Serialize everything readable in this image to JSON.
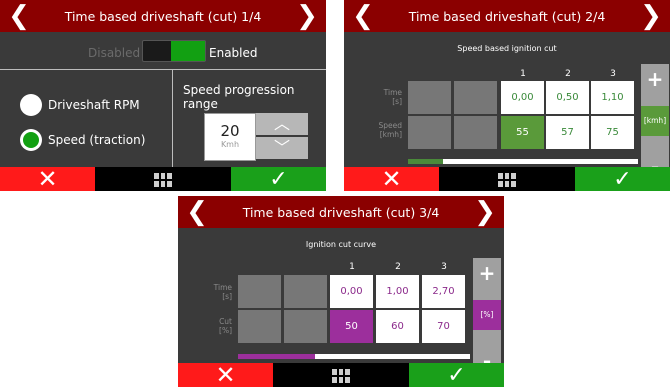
{
  "colors": {
    "title_bar": "#8b0000",
    "cancel": "#ff1a1a",
    "confirm": "#1aa01a",
    "green_accent": "#12a012",
    "purple_accent": "#9c2f9c",
    "value_text": "#8b2a8b"
  },
  "icons": {
    "back": "chevron-left-icon",
    "next": "chevron-right-icon",
    "cancel": "x-icon",
    "menu": "grid-icon",
    "confirm": "check-icon",
    "up": "chevron-up-icon",
    "down": "chevron-down-icon"
  },
  "nav": {
    "prev": "❮",
    "next": "❯",
    "cancel": "✕",
    "confirm": "✓",
    "plus": "+",
    "minus": "-",
    "up": "︿",
    "down": "﹀"
  },
  "screen1": {
    "title": "Time based driveshaft (cut) 1/4",
    "toggle": {
      "off_label": "Disabled",
      "on_label": "Enabled",
      "state": "enabled"
    },
    "options": [
      {
        "label": "Driveshaft RPM",
        "selected": false
      },
      {
        "label": "Speed (traction)",
        "selected": true
      }
    ],
    "speed_range": {
      "title": "Speed progression range",
      "value": "20",
      "unit": "Kmh"
    }
  },
  "screen2": {
    "title": "Time based driveshaft (cut) 2/4",
    "table_title": "Speed based ignition cut",
    "columns": [
      "1",
      "2",
      "3"
    ],
    "rows": [
      {
        "label_top": "Time",
        "label_unit": "[s]",
        "values": [
          "0,00",
          "0,50",
          "1,10"
        ]
      },
      {
        "label_top": "Speed",
        "label_unit": "[kmh]",
        "values": [
          "55",
          "57",
          "75"
        ]
      }
    ],
    "unit_button": "[kmh]",
    "selected_cell": {
      "row": 1,
      "col": 0
    },
    "scroll_progress": 0.15
  },
  "screen3": {
    "title": "Time based driveshaft (cut) 3/4",
    "table_title": "Ignition cut curve",
    "columns": [
      "1",
      "2",
      "3"
    ],
    "rows": [
      {
        "label_top": "Time",
        "label_unit": "[s]",
        "values": [
          "0,00",
          "1,00",
          "2,70"
        ]
      },
      {
        "label_top": "Cut",
        "label_unit": "[%]",
        "values": [
          "50",
          "60",
          "70"
        ]
      }
    ],
    "unit_button": "[%]",
    "selected_cell": {
      "row": 1,
      "col": 0
    },
    "scroll_progress": 0.33
  }
}
